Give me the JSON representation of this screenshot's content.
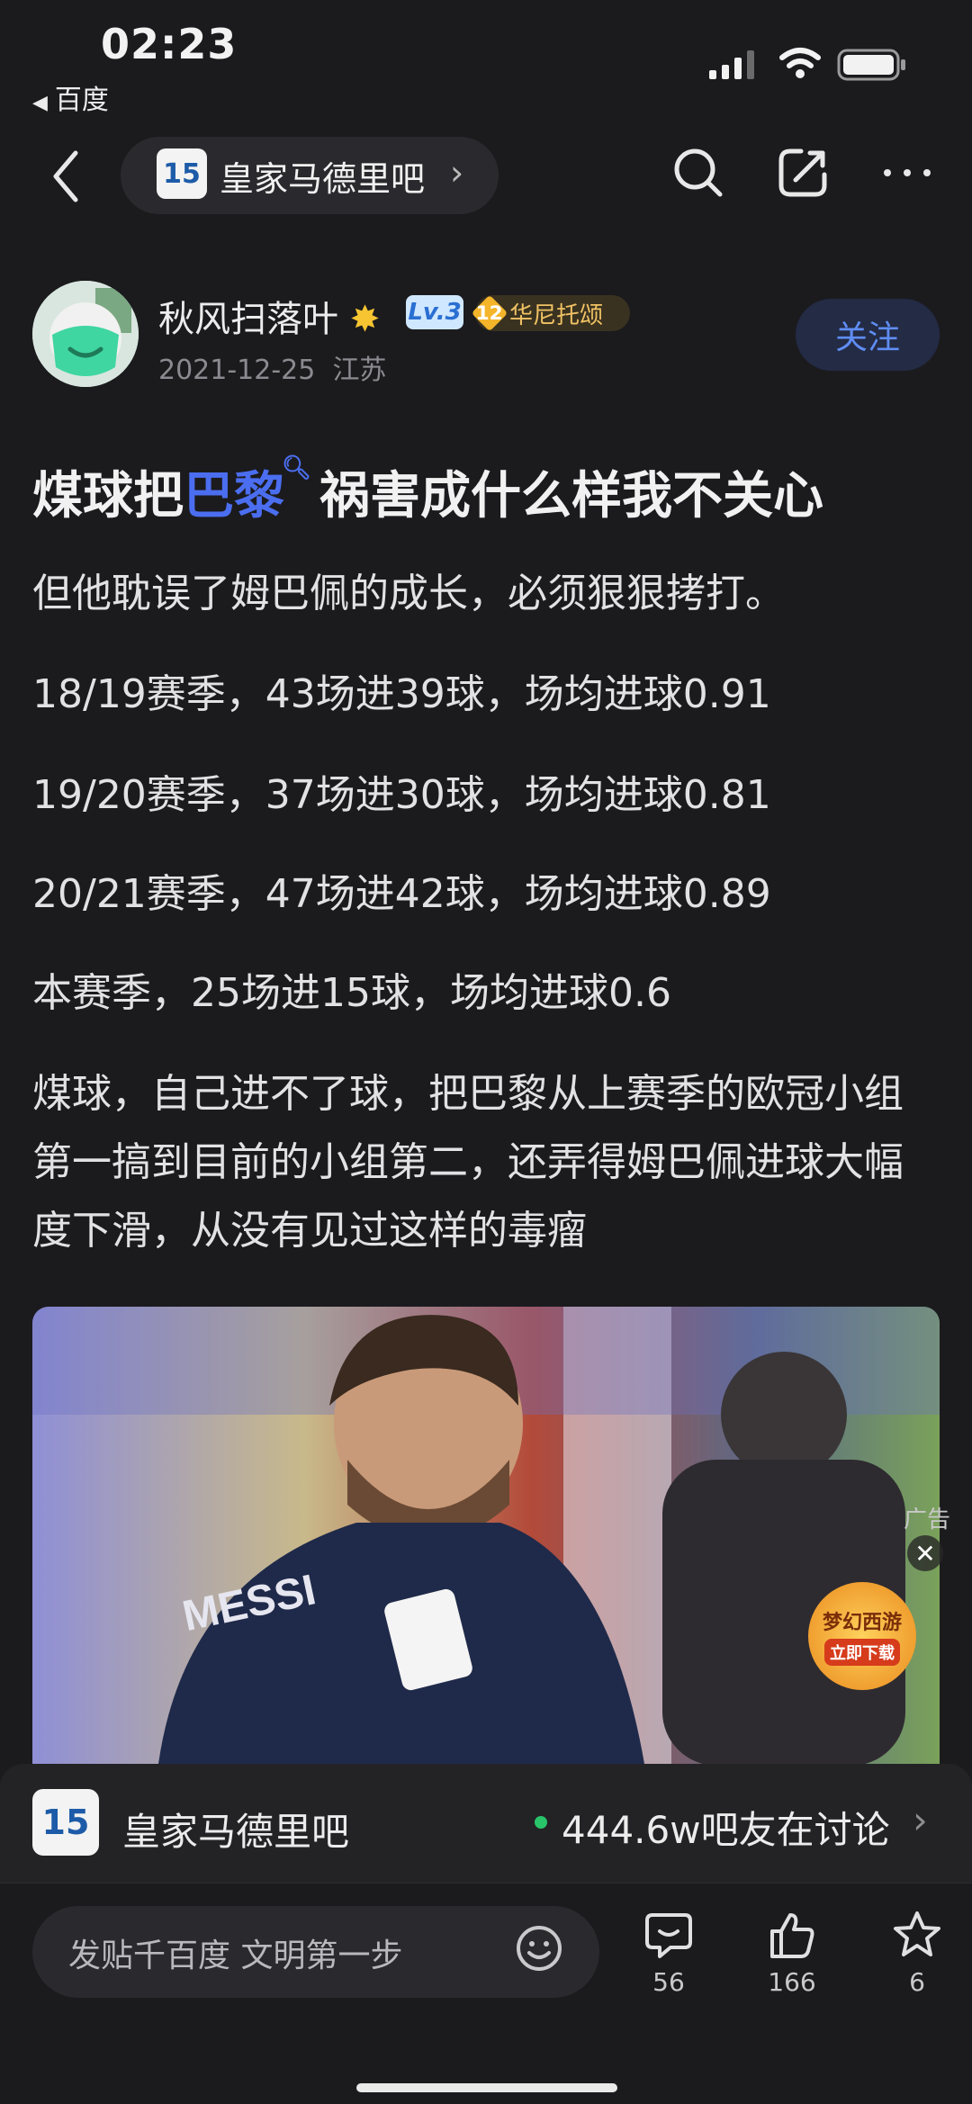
{
  "status_bar": {
    "time": "02:23",
    "back_app": "百度"
  },
  "nav": {
    "forum_name": "皇家马德里吧",
    "forum_logo_text": "15",
    "icons": [
      "back-chevron-icon",
      "search-icon",
      "share-icon",
      "more-icon"
    ]
  },
  "author": {
    "name": "秋风扫落叶",
    "level": "Lv.3",
    "badge_level": "12",
    "badge_name": "华尼托颂",
    "date": "2021-12-25",
    "location": "江苏",
    "follow_label": "关注"
  },
  "post": {
    "title_before": "煤球把",
    "title_link": "巴黎",
    "title_after": "祸害成什么样我不关心",
    "p1": "但他耽误了姆巴佩的成长，必须狠狠拷打。",
    "p2": "18/19赛季，43场进39球，场均进球0.91",
    "p3": "19/20赛季，37场进30球，场均进球0.81",
    "p4": "20/21赛季，47场进42球，场均进球0.89",
    "p5": "本赛季，25场进15球，场均进球0.6",
    "p6": "煤球，自己进不了球，把巴黎从上赛季的欧冠小组第一搞到目前的小组第二，还弄得姆巴佩进球大幅度下滑，从没有见过这样的毒瘤",
    "photo_jersey_text": "MESSI",
    "ad_label": "广告",
    "ad_title": "梦幻西游",
    "ad_cta": "立即下载"
  },
  "forum_bar": {
    "name": "皇家马德里吧",
    "logo_text": "15",
    "discussing": "444.6w吧友在讨论"
  },
  "bottom_bar": {
    "compose_placeholder": "发贴千百度 文明第一步",
    "comments": "56",
    "likes": "166",
    "favorites": "6"
  },
  "colors": {
    "background": "#1b1b1e",
    "accent": "#4b6ef0",
    "follow_text": "#5f8df3",
    "online_dot": "#29c46a"
  }
}
